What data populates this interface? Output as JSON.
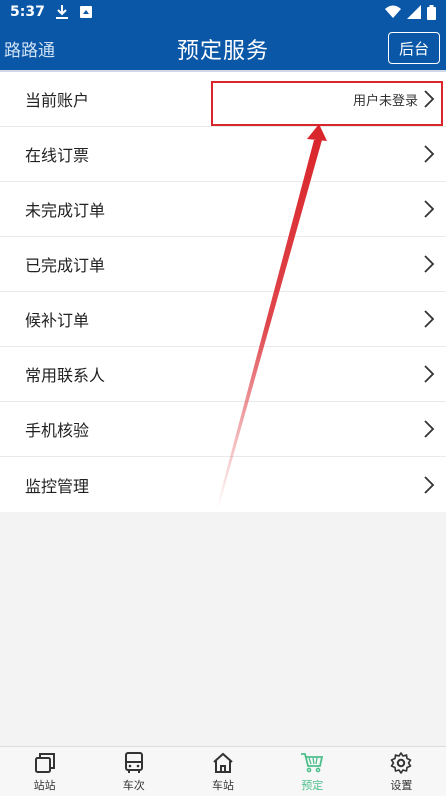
{
  "status_bar": {
    "time": "5:37"
  },
  "header": {
    "back_title": "路路通",
    "title": "预定服务",
    "action_label": "后台"
  },
  "menu": {
    "items": [
      {
        "label": "当前账户",
        "value": "用户未登录"
      },
      {
        "label": "在线订票"
      },
      {
        "label": "未完成订单"
      },
      {
        "label": "已完成订单"
      },
      {
        "label": "候补订单"
      },
      {
        "label": "常用联系人"
      },
      {
        "label": "手机核验"
      },
      {
        "label": "监控管理"
      }
    ]
  },
  "tabbar": {
    "active_index": 3,
    "active_color": "#4cbf8c",
    "tabs": [
      {
        "label": "站站",
        "icon": "copy-icon"
      },
      {
        "label": "车次",
        "icon": "bus-icon"
      },
      {
        "label": "车站",
        "icon": "home-icon"
      },
      {
        "label": "预定",
        "icon": "cart-icon"
      },
      {
        "label": "设置",
        "icon": "gear-icon"
      }
    ]
  },
  "annotation": {
    "highlight_color": "#d9262c"
  }
}
